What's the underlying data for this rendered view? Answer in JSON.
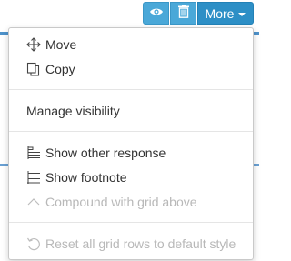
{
  "toolbar": {
    "view_icon": "eye-icon",
    "delete_icon": "trash-icon",
    "more_label": "More",
    "colors": {
      "button": "#4aa8d8",
      "more_button": "#2d8fc6"
    }
  },
  "menu": {
    "items": [
      {
        "label": "Move",
        "icon": "move-arrows-icon",
        "disabled": false
      },
      {
        "label": "Copy",
        "icon": "copy-icon",
        "disabled": false
      },
      {
        "label": "Manage visibility",
        "icon": "",
        "disabled": false
      },
      {
        "label": "Show other response",
        "icon": "list-rows-icon",
        "disabled": false
      },
      {
        "label": "Show footnote",
        "icon": "footnote-icon",
        "disabled": false
      },
      {
        "label": "Compound with grid above",
        "icon": "chevron-up-icon",
        "disabled": true
      },
      {
        "label": "Reset all grid rows to default style",
        "icon": "reset-icon",
        "disabled": true
      }
    ]
  }
}
